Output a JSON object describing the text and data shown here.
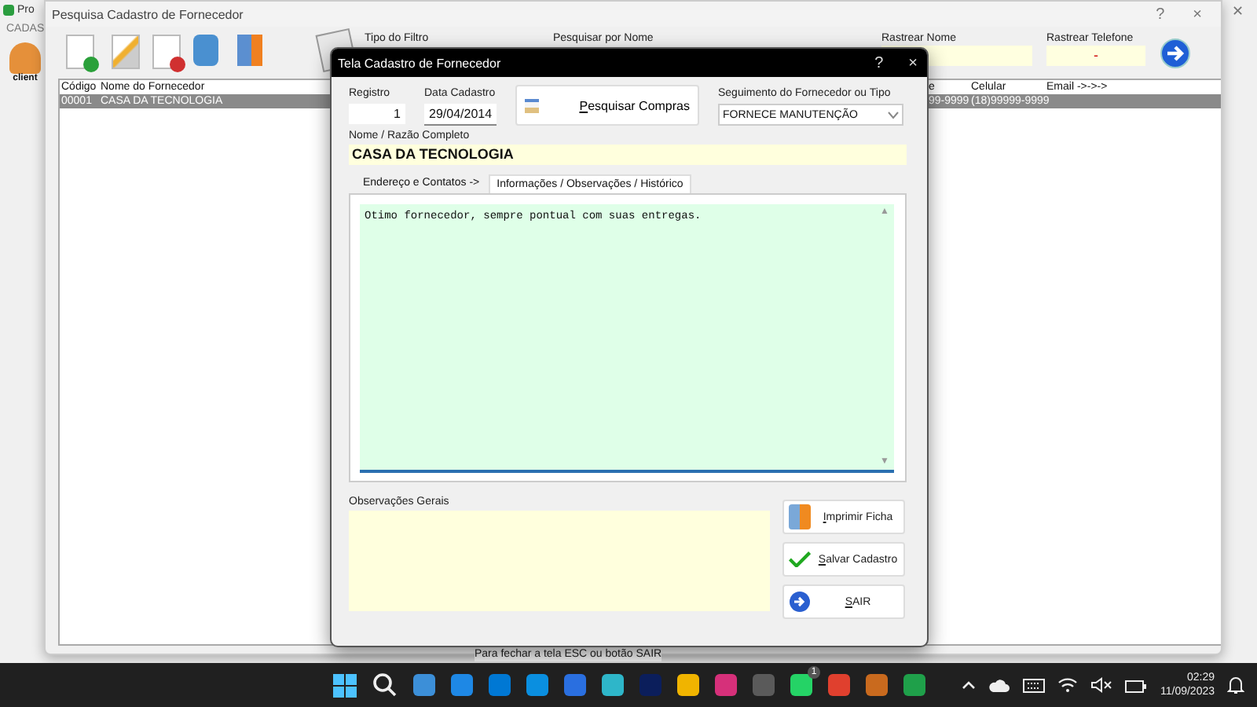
{
  "back_window": {
    "title": "Pro",
    "close": "✕",
    "menu": "CADAS",
    "tool_label": "client"
  },
  "search_window": {
    "title": "Pesquisa Cadastro de Fornecedor",
    "help": "?",
    "close": "×",
    "filter_label": "Tipo do Filtro",
    "name_search_label": "Pesquisar por Nome",
    "track_name_label": "Rastrear Nome",
    "track_phone_label": "Rastrear Telefone",
    "track_phone_value": "-",
    "columns": [
      "Código",
      "Nome do Fornecedor",
      "e",
      "Celular",
      "Email ->->->"
    ],
    "rows": [
      {
        "code": "00001",
        "name": "CASA DA TECNOLOGIA",
        "phone": "99-9999",
        "mobile": "(18)99999-9999",
        "selected": true
      }
    ],
    "hint": "Para fechar a tela ESC ou botão SAIR"
  },
  "dialog": {
    "title": "Tela Cadastro de Fornecedor",
    "help": "?",
    "close": "×",
    "registro_label": "Registro",
    "registro": "1",
    "date_label": "Data Cadastro",
    "date": "29/04/2014",
    "search_purchases": "Pesquisar Compras",
    "segment_label": "Seguimento do Fornecedor ou Tipo",
    "segment": "FORNECE MANUTENÇÃO",
    "name_label": "Nome / Razão Completo",
    "name": "CASA DA TECNOLOGIA",
    "tabs": [
      {
        "label": "Endereço e Contatos ->",
        "selected": false
      },
      {
        "label": "Informações / Observações / Histórico",
        "selected": true
      }
    ],
    "notes": "Otimo fornecedor, sempre pontual com suas entregas.",
    "scroll_up": "▲",
    "scroll_down": "▼",
    "general_label": "Observações Gerais",
    "buttons": [
      {
        "kind": "print",
        "label": "Imprimir Ficha"
      },
      {
        "kind": "save",
        "label": "Salvar Cadastro"
      },
      {
        "kind": "exit",
        "label": "SAIR"
      }
    ]
  },
  "taskbar": {
    "badge": "1",
    "time": "02:29",
    "date": "11/09/2023"
  }
}
